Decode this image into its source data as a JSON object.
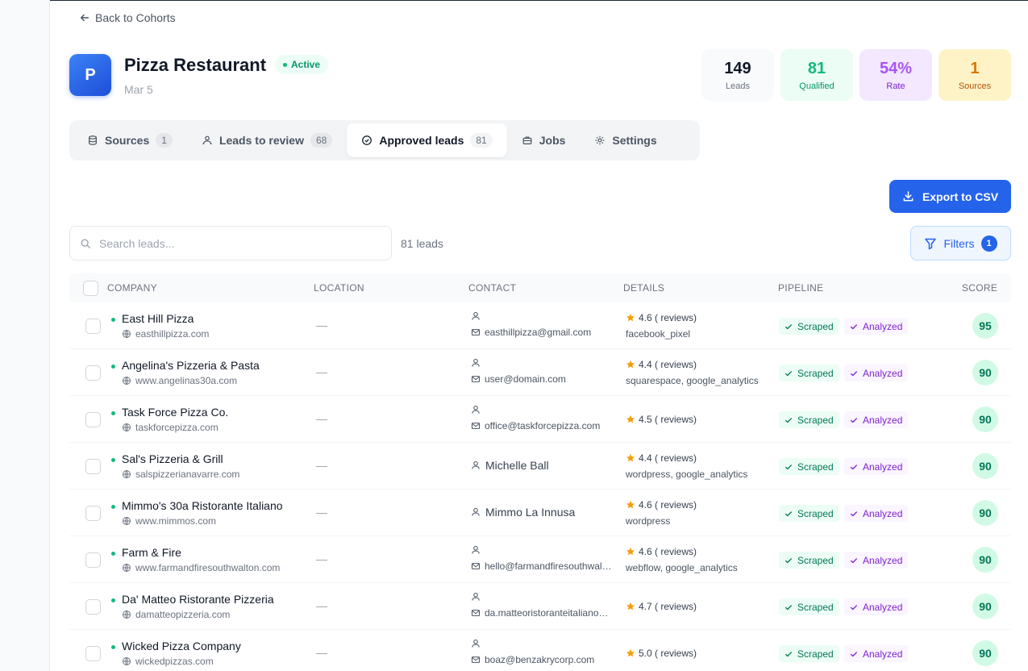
{
  "nav": {
    "back_label": "Back to Cohorts"
  },
  "cohort": {
    "avatar_letter": "P",
    "title": "Pizza Restaurant",
    "status": "Active",
    "date": "Mar 5"
  },
  "stats": [
    {
      "value": "149",
      "label": "Leads"
    },
    {
      "value": "81",
      "label": "Qualified"
    },
    {
      "value": "54%",
      "label": "Rate"
    },
    {
      "value": "1",
      "label": "Sources"
    }
  ],
  "tabs": [
    {
      "label": "Sources",
      "count": "1"
    },
    {
      "label": "Leads to review",
      "count": "68"
    },
    {
      "label": "Approved leads",
      "count": "81"
    },
    {
      "label": "Jobs"
    },
    {
      "label": "Settings"
    }
  ],
  "toolbar": {
    "export_label": "Export to CSV",
    "search_placeholder": "Search leads...",
    "lead_count": "81 leads",
    "filters_label": "Filters",
    "filters_count": "1"
  },
  "table": {
    "headers": [
      "COMPANY",
      "LOCATION",
      "CONTACT",
      "DETAILS",
      "PIPELINE",
      "SCORE"
    ],
    "rows": [
      {
        "company": "East Hill Pizza",
        "website": "easthillpizza.com",
        "location": "—",
        "contact_name": "",
        "email": "easthillpizza@gmail.com",
        "rating": "4.6 ( reviews)",
        "tech": "facebook_pixel",
        "scraped": "Scraped",
        "analyzed": "Analyzed",
        "score": "95"
      },
      {
        "company": "Angelina's Pizzeria & Pasta",
        "website": "www.angelinas30a.com",
        "location": "—",
        "contact_name": "",
        "email": "user@domain.com",
        "rating": "4.4 ( reviews)",
        "tech": "squarespace, google_analytics",
        "scraped": "Scraped",
        "analyzed": "Analyzed",
        "score": "90"
      },
      {
        "company": "Task Force Pizza Co.",
        "website": "taskforcepizza.com",
        "location": "—",
        "contact_name": "",
        "email": "office@taskforcepizza.com",
        "rating": "4.5 ( reviews)",
        "tech": "",
        "scraped": "Scraped",
        "analyzed": "Analyzed",
        "score": "90"
      },
      {
        "company": "Sal's Pizzeria & Grill",
        "website": "salspizzerianavarre.com",
        "location": "—",
        "contact_name": "Michelle Ball",
        "email": "",
        "rating": "4.4 ( reviews)",
        "tech": "wordpress, google_analytics",
        "scraped": "Scraped",
        "analyzed": "Analyzed",
        "score": "90"
      },
      {
        "company": "Mimmo's 30a Ristorante Italiano",
        "website": "www.mimmos.com",
        "location": "—",
        "contact_name": "Mimmo La Innusa",
        "email": "",
        "rating": "4.6 ( reviews)",
        "tech": "wordpress",
        "scraped": "Scraped",
        "analyzed": "Analyzed",
        "score": "90"
      },
      {
        "company": "Farm & Fire",
        "website": "www.farmandfiresouthwalton.com",
        "location": "—",
        "contact_name": "",
        "email": "hello@farmandfiresouthwal…",
        "rating": "4.6 ( reviews)",
        "tech": "webflow, google_analytics",
        "scraped": "Scraped",
        "analyzed": "Analyzed",
        "score": "90"
      },
      {
        "company": "Da' Matteo Ristorante Pizzeria",
        "website": "damatteopizzeria.com",
        "location": "—",
        "contact_name": "",
        "email": "da.matteoristoranteitaliano…",
        "rating": "4.7 ( reviews)",
        "tech": "",
        "scraped": "Scraped",
        "analyzed": "Analyzed",
        "score": "90"
      },
      {
        "company": "Wicked Pizza Company",
        "website": "wickedpizzas.com",
        "location": "—",
        "contact_name": "",
        "email": "boaz@benzakrycorp.com",
        "rating": "5.0 ( reviews)",
        "tech": "",
        "scraped": "Scraped",
        "analyzed": "Analyzed",
        "score": "90"
      }
    ]
  },
  "colors": {
    "primary": "#2563eb",
    "success": "#10b981",
    "purple": "#a855f7",
    "amber": "#d97706",
    "star": "#f59e0b"
  },
  "icons": {
    "back": "arrow-left-icon",
    "search": "search-icon",
    "export": "download-icon",
    "filter": "filter-icon",
    "website": "globe-icon",
    "contact": "user-icon",
    "email": "mail-icon",
    "rating": "star-icon",
    "pipeline": "check-icon"
  }
}
